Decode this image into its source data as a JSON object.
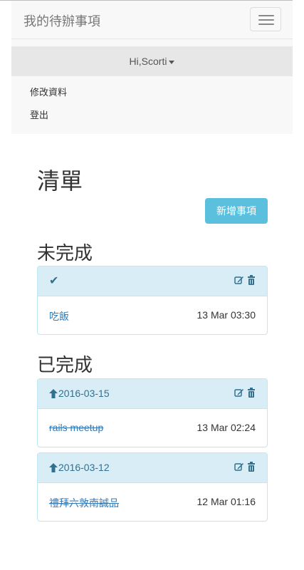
{
  "navbar": {
    "brand": "我的待辦事項",
    "user_menu": "Hi,Scorti",
    "menu_items": [
      "修改資料",
      "登出"
    ]
  },
  "page": {
    "title": "清單",
    "new_button": "新增事項",
    "incomplete_heading": "未完成",
    "complete_heading": "已完成"
  },
  "incomplete": [
    {
      "check_icon": "checkmark-icon",
      "title": "吃飯",
      "time": "13 Mar 03:30"
    }
  ],
  "completed": [
    {
      "date": "2016-03-15",
      "title": "rails meetup",
      "time": "13 Mar 02:24"
    },
    {
      "date": "2016-03-12",
      "title": "禮拜六敦南誠品",
      "time": "12 Mar 01:16"
    }
  ],
  "colors": {
    "panel_heading_bg": "#d9edf7",
    "panel_border": "#bce8f1",
    "info_button": "#5bc0de",
    "link": "#337ab7"
  }
}
